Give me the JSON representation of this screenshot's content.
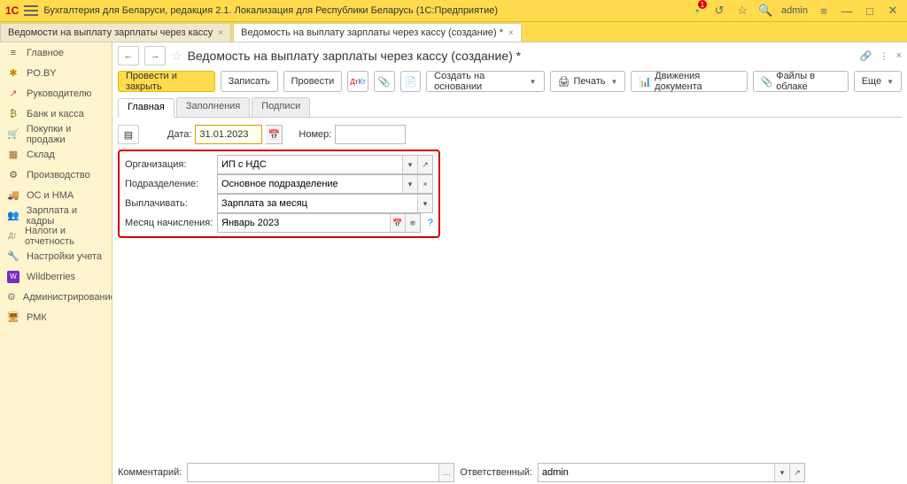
{
  "titlebar": {
    "app_title": "Бухгалтерия для Беларуси, редакция 2.1. Локализация для Республики Беларусь   (1С:Предприятие)",
    "user": "admin"
  },
  "tabs": [
    {
      "label": "Ведомости на выплату зарплаты через кассу",
      "active": false
    },
    {
      "label": "Ведомость на выплату зарплаты через кассу (создание) *",
      "active": true
    }
  ],
  "sidebar": [
    {
      "icon": "≡",
      "label": "Главное",
      "color": "#555"
    },
    {
      "icon": "✱",
      "label": "PO.BY",
      "color": "#d08000"
    },
    {
      "icon": "↗",
      "label": "Руководителю",
      "color": "#d05080"
    },
    {
      "icon": "₿",
      "label": "Банк и касса",
      "color": "#6a8a2a"
    },
    {
      "icon": "🛒",
      "label": "Покупки и продажи",
      "color": "#b04000"
    },
    {
      "icon": "▦",
      "label": "Склад",
      "color": "#a06030"
    },
    {
      "icon": "⚙",
      "label": "Производство",
      "color": "#555"
    },
    {
      "icon": "🚚",
      "label": "ОС и НМА",
      "color": "#c04000"
    },
    {
      "icon": "👥",
      "label": "Зарплата и кадры",
      "color": "#a04000"
    },
    {
      "icon": "Дт",
      "label": "Налоги и отчетность",
      "color": "#888"
    },
    {
      "icon": "🔧",
      "label": "Настройки учета",
      "color": "#777"
    },
    {
      "icon": "W",
      "label": "Wildberries",
      "color": "#7b2cbf"
    },
    {
      "icon": "⚙",
      "label": "Администрирование",
      "color": "#777"
    },
    {
      "icon": "🖥",
      "label": "РМК",
      "color": "#b06000"
    }
  ],
  "document": {
    "title": "Ведомость на выплату зарплаты через кассу (создание) *"
  },
  "toolbar": {
    "post_close": "Провести и закрыть",
    "save": "Записать",
    "post": "Провести",
    "create_based": "Создать на основании",
    "print": "Печать",
    "movements": "Движения документа",
    "files": "Файлы в облаке",
    "more": "Еще"
  },
  "subtabs": {
    "main": "Главная",
    "fill": "Заполнения",
    "sign": "Подписи"
  },
  "form": {
    "date_label": "Дата:",
    "date_value": "31.01.2023",
    "number_label": "Номер:",
    "number_value": "",
    "org_label": "Организация:",
    "org_value": "ИП с НДС",
    "dept_label": "Подразделение:",
    "dept_value": "Основное подразделение",
    "pay_label": "Выплачивать:",
    "pay_value": "Зарплата за месяц",
    "month_label": "Месяц начисления:",
    "month_value": "Январь 2023"
  },
  "footer": {
    "comment_label": "Комментарий:",
    "comment_value": "",
    "resp_label": "Ответственный:",
    "resp_value": "admin"
  }
}
